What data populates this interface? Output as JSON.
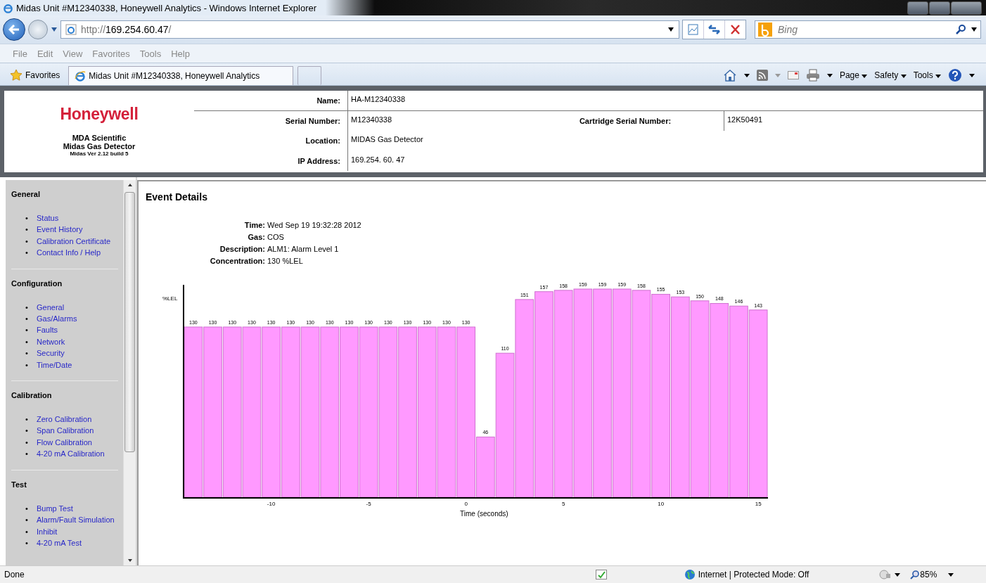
{
  "window": {
    "title": "Midas Unit #M12340338, Honeywell Analytics - Windows Internet Explorer"
  },
  "address_bar": {
    "prefix": "http://",
    "host": "169.254.60.47",
    "suffix": "/"
  },
  "search": {
    "placeholder": "Bing"
  },
  "menu": [
    "File",
    "Edit",
    "View",
    "Favorites",
    "Tools",
    "Help"
  ],
  "favorites_button": "Favorites",
  "tabs": [
    {
      "label": "Midas Unit #M12340338, Honeywell Analytics",
      "selected": true
    }
  ],
  "command_bar": [
    "Page",
    "Safety",
    "Tools"
  ],
  "header": {
    "logo": "Honeywell",
    "lines": [
      "MDA Scientific",
      "Midas Gas Detector",
      "Midas Ver 2.12 build 5"
    ],
    "fields": [
      {
        "label": "Name:",
        "value": "HA-M12340338"
      },
      {
        "label": "Serial Number:",
        "value": "M12340338"
      },
      {
        "label": "Location:",
        "value": "MIDAS Gas Detector"
      },
      {
        "label": "IP Address:",
        "value": "169.254. 60. 47"
      }
    ],
    "cartridge": {
      "label": "Cartridge Serial Number:",
      "value": "12K50491"
    }
  },
  "sidebar": {
    "bullet": "•",
    "sections": [
      {
        "title": "General",
        "items": [
          "Status",
          "Event History",
          "Calibration Certificate",
          "Contact Info / Help"
        ]
      },
      {
        "title": "Configuration",
        "items": [
          "General",
          "Gas/Alarms",
          "Faults",
          "Network",
          "Security",
          "Time/Date"
        ]
      },
      {
        "title": "Calibration",
        "items": [
          "Zero Calibration",
          "Span Calibration",
          "Flow Calibration",
          "4-20 mA Calibration"
        ]
      },
      {
        "title": "Test",
        "items": [
          "Bump Test",
          "Alarm/Fault Simulation",
          "Inhibit",
          "4-20 mA Test"
        ]
      }
    ]
  },
  "event": {
    "title": "Event Details",
    "details": [
      {
        "label": "Time:",
        "value": "Wed Sep 19 19:32:28 2012"
      },
      {
        "label": "Gas:",
        "value": "COS"
      },
      {
        "label": "Description:",
        "value": "ALM1: Alarm Level 1"
      },
      {
        "label": "Concentration:",
        "value": "130 %LEL"
      }
    ],
    "chart_data": {
      "type": "bar",
      "xlabel": "Time (seconds)",
      "annotations": [
        "%LEL"
      ],
      "x": [
        -14,
        -13,
        -12,
        -11,
        -10,
        -9,
        -8,
        -7,
        -6,
        -5,
        -4,
        -3,
        -2,
        -1,
        0,
        1,
        2,
        3,
        4,
        5,
        6,
        7,
        8,
        9,
        10,
        11,
        12,
        13,
        14,
        15
      ],
      "series": [
        {
          "color": "#ff99ff",
          "values": [
            130,
            130,
            130,
            130,
            130,
            130,
            130,
            130,
            130,
            130,
            130,
            130,
            130,
            130,
            130,
            46,
            110,
            151,
            157,
            158,
            159,
            159,
            159,
            158,
            155,
            153,
            150,
            148,
            146,
            143
          ]
        }
      ],
      "xlim": [
        -14.5,
        15.5
      ],
      "xticks": [
        -10,
        -5,
        0,
        5,
        10,
        15
      ],
      "data_labels": true
    }
  },
  "status_bar": {
    "text": "Done",
    "zone": "Internet | Protected Mode: Off",
    "zoom": "85%"
  }
}
